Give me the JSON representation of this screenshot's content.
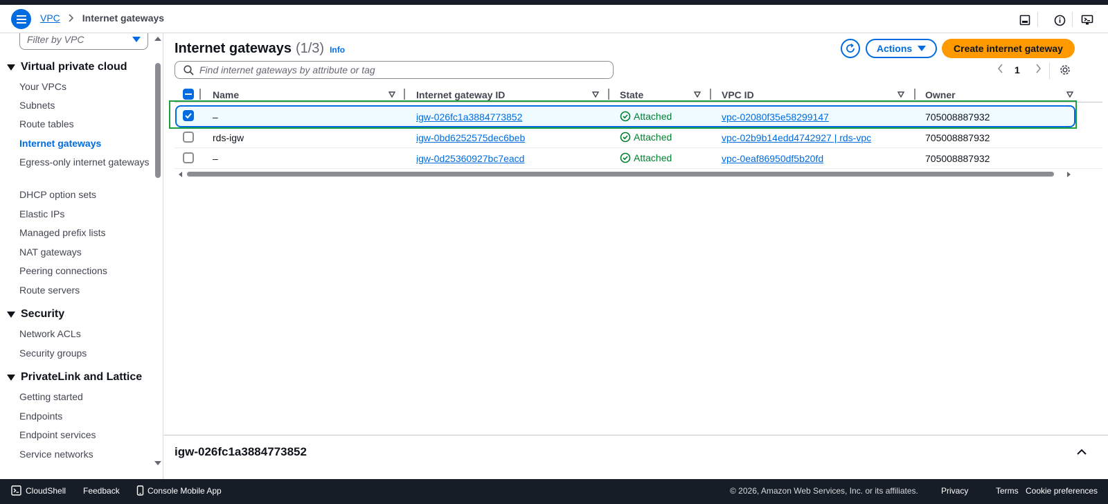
{
  "header": {
    "breadcrumb_root": "VPC",
    "breadcrumb_current": "Internet gateways"
  },
  "sidebar": {
    "filter_placeholder": "Filter by VPC",
    "sections": [
      {
        "label": "Virtual private cloud"
      },
      {
        "label": "Security"
      },
      {
        "label": "PrivateLink and Lattice"
      }
    ],
    "vpc_items": [
      "Your VPCs",
      "Subnets",
      "Route tables",
      "Internet gateways",
      "Egress-only internet gateways",
      "DHCP option sets",
      "Elastic IPs",
      "Managed prefix lists",
      "NAT gateways",
      "Peering connections",
      "Route servers"
    ],
    "security_items": [
      "Network ACLs",
      "Security groups"
    ],
    "privatelink_items": [
      "Getting started",
      "Endpoints",
      "Endpoint services",
      "Service networks"
    ],
    "active_item": "Internet gateways"
  },
  "main": {
    "title": "Internet gateways",
    "count": "(1/3)",
    "info_label": "Info",
    "actions_label": "Actions",
    "create_label": "Create internet gateway",
    "search_placeholder": "Find internet gateways by attribute or tag",
    "page_number": "1",
    "columns": [
      "Name",
      "Internet gateway ID",
      "State",
      "VPC ID",
      "Owner"
    ],
    "rows": [
      {
        "name": "–",
        "id": "igw-026fc1a3884773852",
        "state": "Attached",
        "vpc": "vpc-02080f35e58299147",
        "owner": "705008887932",
        "selected": true
      },
      {
        "name": "rds-igw",
        "id": "igw-0bd6252575dec6beb",
        "state": "Attached",
        "vpc": "vpc-02b9b14edd4742927 | rds-vpc",
        "owner": "705008887932",
        "selected": false
      },
      {
        "name": "–",
        "id": "igw-0d25360927bc7eacd",
        "state": "Attached",
        "vpc": "vpc-0eaf86950df5b20fd",
        "owner": "705008887932",
        "selected": false
      }
    ]
  },
  "detail": {
    "title": "igw-026fc1a3884773852"
  },
  "footer": {
    "cloudshell": "CloudShell",
    "feedback": "Feedback",
    "mobile_app": "Console Mobile App",
    "copyright": "© 2026, Amazon Web Services, Inc. or its affiliates.",
    "privacy": "Privacy",
    "terms": "Terms",
    "cookies": "Cookie preferences"
  },
  "colors": {
    "accent": "#006ce0",
    "primary_button": "#ff9900",
    "success": "#00802f",
    "highlight_box": "#1e9e3e",
    "dark_bar": "#161d26"
  }
}
